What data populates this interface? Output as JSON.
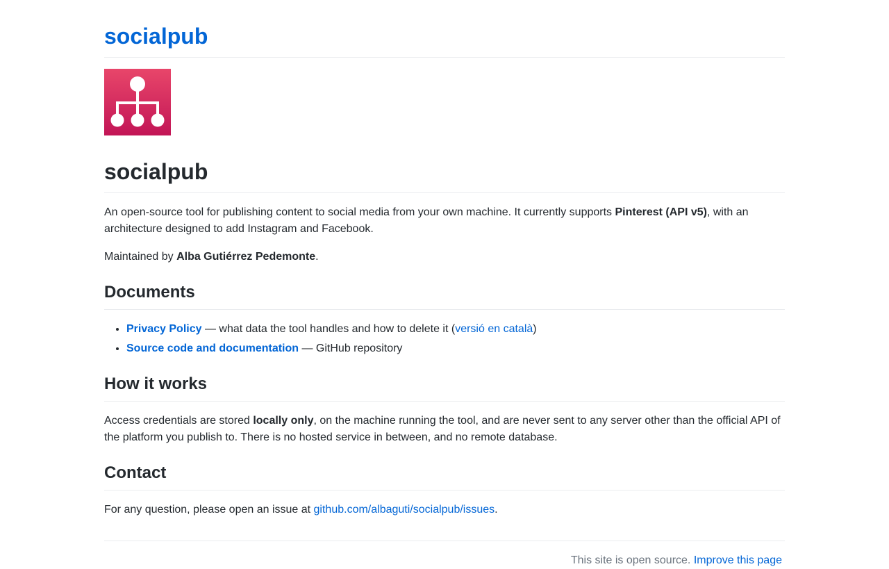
{
  "header": {
    "site_title": "socialpub"
  },
  "logo": {
    "icon": "sitemap-icon",
    "bg_top": "#e8466a",
    "bg_bottom": "#c21556",
    "fg": "#ffffff"
  },
  "main": {
    "title": "socialpub",
    "intro": {
      "text_before": "An open-source tool for publishing content to social media from your own machine. It currently supports ",
      "bold": "Pinterest (API v5)",
      "text_after": ", with an architecture designed to add Instagram and Facebook."
    },
    "maintainer": {
      "prefix": "Maintained by ",
      "name": "Alba Gutiérrez Pedemonte",
      "suffix": "."
    }
  },
  "documents": {
    "heading": "Documents",
    "items": [
      {
        "link": "Privacy Policy",
        "text": " — what data the tool handles and how to delete it (",
        "sublink": "versió en català",
        "end": ")"
      },
      {
        "link": "Source code and documentation",
        "text": " — GitHub repository"
      }
    ]
  },
  "how_it_works": {
    "heading": "How it works",
    "text_before": "Access credentials are stored ",
    "bold": "locally only",
    "text_after": ", on the machine running the tool, and are never sent to any server other than the official API of the platform you publish to. There is no hosted service in between, and no remote database."
  },
  "contact": {
    "heading": "Contact",
    "text_before": "For any question, please open an issue at ",
    "link": "github.com/albaguti/socialpub/issues",
    "text_after": "."
  },
  "footer": {
    "text": "This site is open source. ",
    "link": "Improve this page"
  },
  "colors": {
    "link": "#0366d6",
    "text": "#24292e",
    "muted": "#6a737d",
    "rule": "#eaecef"
  }
}
